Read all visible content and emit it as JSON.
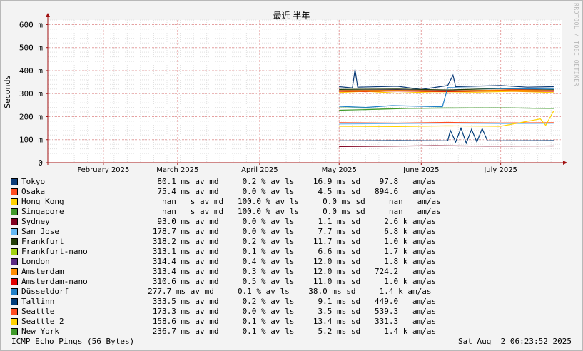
{
  "title": "最近 半年",
  "watermark": "RRDTOOL / TOBI OETIKER",
  "footer": {
    "left": "ICMP Echo Pings (56 Bytes)",
    "right": "Sat Aug  2 06:23:52 2025"
  },
  "colors": {
    "background": "#f3f3f3",
    "plot_background": "#ffffff",
    "minor_grid": "#e0e0e0",
    "major_grid": "#e6a0a0",
    "axis": "#a01010"
  },
  "chart_data": {
    "type": "line",
    "title": "最近 半年",
    "ylabel": "Seconds",
    "xlabel": "",
    "y_unit": "m",
    "ylim_ms": [
      0,
      620
    ],
    "yticks_ms": [
      0,
      100,
      200,
      300,
      400,
      500,
      600
    ],
    "ytick_labels": [
      "0",
      "100 m",
      "200 m",
      "300 m",
      "400 m",
      "500 m",
      "600 m"
    ],
    "xlim": [
      "2025-01-20",
      "2025-08-02"
    ],
    "xticks": [
      {
        "label": "February 2025",
        "date": "2025-02-10"
      },
      {
        "label": "March 2025",
        "date": "2025-03-10"
      },
      {
        "label": "April 2025",
        "date": "2025-04-10"
      },
      {
        "label": "May 2025",
        "date": "2025-05-10"
      },
      {
        "label": "June 2025",
        "date": "2025-06-10"
      },
      {
        "label": "July 2025",
        "date": "2025-07-10"
      }
    ],
    "grid": true,
    "data_start": "2025-05-10",
    "series": [
      {
        "name": "Tokyo",
        "color": "#0d3c78",
        "points": [
          [
            "2025-05-10",
            330
          ],
          [
            "2025-05-15",
            325
          ],
          [
            "2025-05-16",
            405
          ],
          [
            "2025-05-17",
            328
          ],
          [
            "2025-06-01",
            332
          ],
          [
            "2025-06-10",
            318
          ],
          [
            "2025-06-20",
            335
          ],
          [
            "2025-06-22",
            380
          ],
          [
            "2025-06-23",
            330
          ],
          [
            "2025-07-10",
            335
          ],
          [
            "2025-07-20",
            328
          ],
          [
            "2025-07-30",
            330
          ]
        ]
      },
      {
        "name": "Osaka",
        "color": "#ff4b1f",
        "points": [
          [
            "2025-05-10",
            312
          ],
          [
            "2025-05-20",
            308
          ],
          [
            "2025-06-01",
            315
          ],
          [
            "2025-06-15",
            310
          ],
          [
            "2025-07-01",
            312
          ],
          [
            "2025-07-15",
            318
          ],
          [
            "2025-07-30",
            314
          ]
        ]
      },
      {
        "name": "Hong Kong",
        "color": "#ffd200",
        "points": [
          [
            "2025-05-10",
            305
          ],
          [
            "2025-05-20",
            310
          ],
          [
            "2025-06-01",
            302
          ],
          [
            "2025-06-15",
            308
          ],
          [
            "2025-07-01",
            306
          ],
          [
            "2025-07-15",
            310
          ],
          [
            "2025-07-30",
            304
          ]
        ]
      },
      {
        "name": "Singapore",
        "color": "#3f9a2a",
        "points": [
          [
            "2025-05-10",
            228
          ],
          [
            "2025-05-25",
            232
          ],
          [
            "2025-06-05",
            236
          ],
          [
            "2025-06-20",
            238
          ],
          [
            "2025-07-10",
            238
          ],
          [
            "2025-07-30",
            236
          ]
        ]
      },
      {
        "name": "Sydney",
        "color": "#800020",
        "points": [
          [
            "2025-05-10",
            70
          ],
          [
            "2025-05-30",
            72
          ],
          [
            "2025-06-15",
            74
          ],
          [
            "2025-07-05",
            72
          ],
          [
            "2025-07-30",
            73
          ]
        ]
      },
      {
        "name": "San Jose",
        "color": "#64b8f4",
        "points": [
          [
            "2025-05-10",
            168
          ],
          [
            "2025-06-01",
            170
          ],
          [
            "2025-06-20",
            172
          ],
          [
            "2025-07-10",
            170
          ],
          [
            "2025-07-30",
            171
          ]
        ]
      },
      {
        "name": "Frankfurt",
        "color": "#233f08",
        "points": [
          [
            "2025-05-10",
            318
          ],
          [
            "2025-06-01",
            320
          ],
          [
            "2025-06-20",
            316
          ],
          [
            "2025-07-10",
            322
          ],
          [
            "2025-07-30",
            318
          ]
        ]
      },
      {
        "name": "Frankfurt-nano",
        "color": "#a0d210",
        "points": [
          [
            "2025-05-10",
            313
          ],
          [
            "2025-06-01",
            314
          ],
          [
            "2025-06-20",
            312
          ],
          [
            "2025-07-10",
            315
          ],
          [
            "2025-07-30",
            313
          ]
        ]
      },
      {
        "name": "London",
        "color": "#5a2882",
        "points": [
          [
            "2025-05-10",
            314
          ],
          [
            "2025-06-01",
            316
          ],
          [
            "2025-06-20",
            313
          ],
          [
            "2025-07-10",
            315
          ],
          [
            "2025-07-30",
            314
          ]
        ]
      },
      {
        "name": "Amsterdam",
        "color": "#ff8c00",
        "points": [
          [
            "2025-05-10",
            313
          ],
          [
            "2025-06-01",
            314
          ],
          [
            "2025-06-20",
            312
          ],
          [
            "2025-07-10",
            315
          ],
          [
            "2025-07-30",
            313
          ]
        ]
      },
      {
        "name": "Amsterdam-nano",
        "color": "#e10000",
        "points": [
          [
            "2025-05-10",
            310
          ],
          [
            "2025-06-01",
            311
          ],
          [
            "2025-06-20",
            309
          ],
          [
            "2025-07-10",
            312
          ],
          [
            "2025-07-30",
            310
          ]
        ]
      },
      {
        "name": "Düsseldorf",
        "color": "#2080c8",
        "points": [
          [
            "2025-05-10",
            245
          ],
          [
            "2025-05-20",
            240
          ],
          [
            "2025-05-30",
            248
          ],
          [
            "2025-06-10",
            245
          ],
          [
            "2025-06-18",
            243
          ],
          [
            "2025-06-20",
            326
          ],
          [
            "2025-07-10",
            322
          ],
          [
            "2025-07-30",
            320
          ]
        ]
      },
      {
        "name": "Tallinn",
        "color": "#003c7a",
        "points": [
          [
            "2025-05-10",
            95
          ],
          [
            "2025-06-01",
            96
          ],
          [
            "2025-06-20",
            95
          ],
          [
            "2025-06-21",
            140
          ],
          [
            "2025-06-23",
            90
          ],
          [
            "2025-06-25",
            150
          ],
          [
            "2025-06-27",
            85
          ],
          [
            "2025-06-29",
            145
          ],
          [
            "2025-07-01",
            90
          ],
          [
            "2025-07-03",
            148
          ],
          [
            "2025-07-05",
            95
          ],
          [
            "2025-07-30",
            96
          ]
        ]
      },
      {
        "name": "Seattle",
        "color": "#ff4b1f",
        "points": [
          [
            "2025-05-10",
            174
          ],
          [
            "2025-06-01",
            172
          ],
          [
            "2025-06-20",
            175
          ],
          [
            "2025-07-10",
            173
          ],
          [
            "2025-07-30",
            174
          ]
        ]
      },
      {
        "name": "Seattle 2",
        "color": "#ffd200",
        "points": [
          [
            "2025-05-10",
            158
          ],
          [
            "2025-06-01",
            157
          ],
          [
            "2025-06-20",
            160
          ],
          [
            "2025-07-10",
            158
          ],
          [
            "2025-07-25",
            190
          ],
          [
            "2025-07-27",
            162
          ],
          [
            "2025-07-30",
            225
          ]
        ]
      },
      {
        "name": "New York",
        "color": "#3f9a2a",
        "points": [
          [
            "2025-05-10",
            238
          ],
          [
            "2025-06-01",
            236
          ],
          [
            "2025-06-20",
            237
          ],
          [
            "2025-07-10",
            238
          ],
          [
            "2025-07-30",
            236
          ]
        ]
      }
    ]
  },
  "legend": [
    {
      "name": "Tokyo",
      "color": "#0d3c78",
      "stats": "       80.1 ms av md     0.2 % av ls    16.9 ms sd    97.8   am/as"
    },
    {
      "name": "Osaka",
      "color": "#ff4b1f",
      "stats": "       75.4 ms av md     0.0 % av ls     4.5 ms sd   894.6   am/as"
    },
    {
      "name": "Hong Kong",
      "color": "#ffd200",
      "stats": "        nan   s av md   100.0 % av ls     0.0 ms sd     nan   am/as"
    },
    {
      "name": "Singapore",
      "color": "#3f9a2a",
      "stats": "        nan   s av md   100.0 % av ls     0.0 ms sd     nan   am/as"
    },
    {
      "name": "Sydney",
      "color": "#800020",
      "stats": "       93.0 ms av md     0.0 % av ls     1.1 ms sd     2.6 k am/as"
    },
    {
      "name": "San Jose",
      "color": "#64b8f4",
      "stats": "      178.7 ms av md     0.0 % av ls     7.7 ms sd     6.8 k am/as"
    },
    {
      "name": "Frankfurt",
      "color": "#233f08",
      "stats": "      318.2 ms av md     0.2 % av ls    11.7 ms sd     1.0 k am/as"
    },
    {
      "name": "Frankfurt-nano",
      "color": "#a0d210",
      "stats": "      313.1 ms av md     0.1 % av ls     6.6 ms sd     1.7 k am/as"
    },
    {
      "name": "London",
      "color": "#5a2882",
      "stats": "      314.4 ms av md     0.4 % av ls    12.0 ms sd     1.8 k am/as"
    },
    {
      "name": "Amsterdam",
      "color": "#ff8c00",
      "stats": "      313.4 ms av md     0.3 % av ls    12.0 ms sd   724.2   am/as"
    },
    {
      "name": "Amsterdam-nano",
      "color": "#e10000",
      "stats": "      310.6 ms av md     0.5 % av ls    11.0 ms sd     1.0 k am/as"
    },
    {
      "name": "Düsseldorf",
      "color": "#2080c8",
      "stats": "     277.7 ms av md     0.1 % av ls    38.0 ms sd     1.4 k am/as"
    },
    {
      "name": "Tallinn",
      "color": "#003c7a",
      "stats": "      333.5 ms av md     0.2 % av ls     9.1 ms sd   449.0   am/as"
    },
    {
      "name": "Seattle",
      "color": "#ff4b1f",
      "stats": "      173.3 ms av md     0.0 % av ls     3.5 ms sd   539.3   am/as"
    },
    {
      "name": "Seattle 2",
      "color": "#ffd200",
      "stats": "      158.6 ms av md     0.1 % av ls    13.4 ms sd   331.3   am/as"
    },
    {
      "name": "New York",
      "color": "#3f9a2a",
      "stats": "      236.7 ms av md     0.1 % av ls     5.2 ms sd     1.4 k am/as"
    }
  ]
}
